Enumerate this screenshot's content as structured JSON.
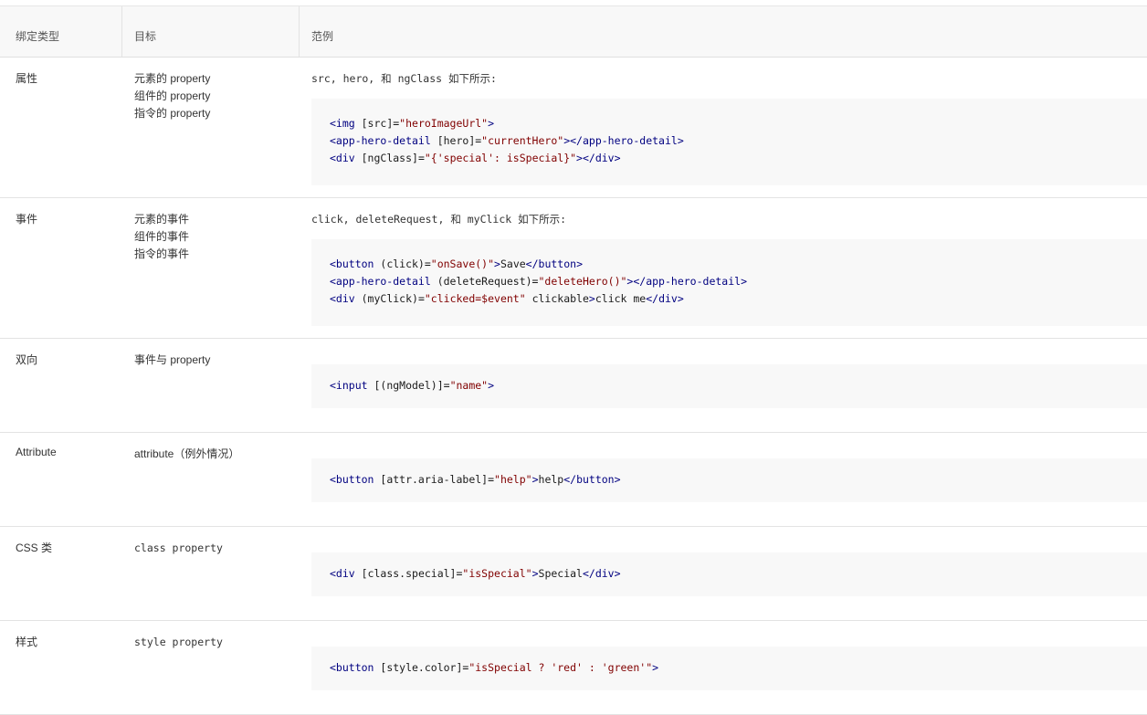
{
  "header": {
    "col1": "绑定类型",
    "col2": "目标",
    "col3": "范例"
  },
  "rows": [
    {
      "type": "属性",
      "targets": [
        "元素的 property",
        "组件的 property",
        "指令的 property"
      ],
      "desc": {
        "pre": "src, hero, 和 ngClass 如下所示:"
      },
      "code": [
        "<img [src]=\"heroImageUrl\">",
        "<app-hero-detail [hero]=\"currentHero\"></app-hero-detail>",
        "<div [ngClass]=\"{'special': isSpecial}\"></div>"
      ]
    },
    {
      "type": "事件",
      "targets": [
        "元素的事件",
        "组件的事件",
        "指令的事件"
      ],
      "desc": {
        "pre": "click, deleteRequest, 和 myClick 如下所示:"
      },
      "code": [
        "<button (click)=\"onSave()\">Save</button>",
        "<app-hero-detail (deleteRequest)=\"deleteHero()\"></app-hero-detail>",
        "<div (myClick)=\"clicked=$event\" clickable>click me</div>"
      ]
    },
    {
      "type": "双向",
      "targets": [
        "事件与 property"
      ],
      "desc": {
        "pre": ""
      },
      "code": [
        "<input [(ngModel)]=\"name\">"
      ]
    },
    {
      "type": "Attribute",
      "targets": [
        "attribute（例外情况）"
      ],
      "desc": {
        "pre": ""
      },
      "code": [
        "<button [attr.aria-label]=\"help\">help</button>"
      ]
    },
    {
      "type": "CSS 类",
      "targets": [
        "class property"
      ],
      "desc": {
        "pre": ""
      },
      "code": [
        "<div [class.special]=\"isSpecial\">Special</div>"
      ]
    },
    {
      "type": "样式",
      "targets": [
        "style property"
      ],
      "desc": {
        "pre": ""
      },
      "code": [
        "<button [style.color]=\"isSpecial ? 'red' : 'green'\">"
      ]
    }
  ]
}
